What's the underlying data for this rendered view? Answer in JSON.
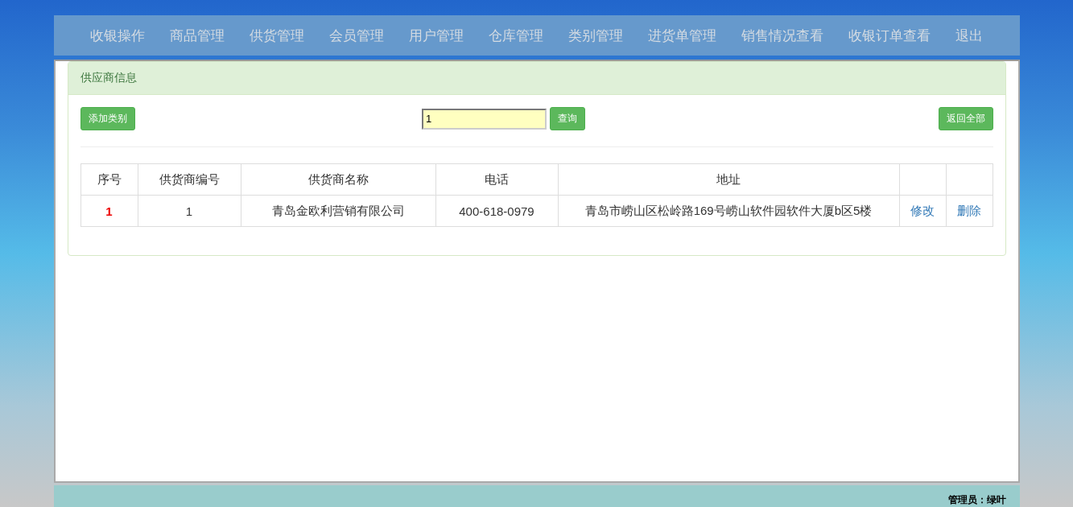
{
  "nav": {
    "items": [
      {
        "label": "收银操作"
      },
      {
        "label": "商品管理"
      },
      {
        "label": "供货管理"
      },
      {
        "label": "会员管理"
      },
      {
        "label": "用户管理"
      },
      {
        "label": "仓库管理"
      },
      {
        "label": "类别管理"
      },
      {
        "label": "进货单管理"
      },
      {
        "label": "销售情况查看"
      },
      {
        "label": "收银订单查看"
      },
      {
        "label": "退出"
      }
    ]
  },
  "panel": {
    "title": "供应商信息",
    "add_button": "添加类别",
    "search": {
      "value": "1"
    },
    "search_button": "查询",
    "reset_button": "返回全部",
    "table": {
      "columns": [
        "序号",
        "供货商编号",
        "供货商名称",
        "电话",
        "地址"
      ],
      "rows": [
        {
          "cells": [
            "1",
            "1",
            "青岛金欧利营销有限公司",
            "400-618-0979",
            "青岛市崂山区松岭路169号崂山软件园软件大厦b区5楼"
          ],
          "actions": [
            "修改",
            "删除"
          ]
        }
      ]
    }
  },
  "footer": {
    "admin": "管理员：绿叶"
  }
}
